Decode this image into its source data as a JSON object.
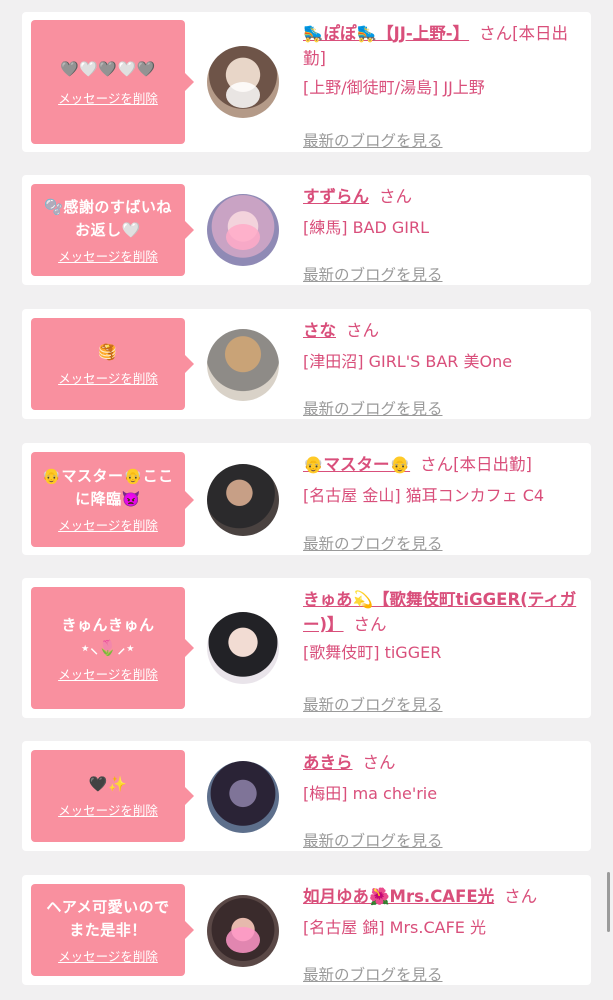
{
  "cards": [
    {
      "message": "🩶🤍🩶🤍🩶",
      "delete_label": "メッセージを削除",
      "name": "🛼ぽぽ🛼【JJ-上野-】",
      "san": "さん",
      "status": "[本日出勤]",
      "shop": "[上野/御徒町/湯島] JJ上野",
      "blog_label": "最新のブログを見る"
    },
    {
      "message": "🫧感謝のすばいね お返し🤍",
      "delete_label": "メッセージを削除",
      "name": "すずらん",
      "san": "さん",
      "status": "",
      "shop": "[練馬] BAD GIRL",
      "blog_label": "最新のブログを見る"
    },
    {
      "message": "🥞",
      "delete_label": "メッセージを削除",
      "name": "さな",
      "san": "さん",
      "status": "",
      "shop": "[津田沼] GIRL'S BAR 美One",
      "blog_label": "最新のブログを見る"
    },
    {
      "message": "👴マスター👴ここに降臨👿",
      "delete_label": "メッセージを削除",
      "name": "👴マスター👴",
      "san": "さん",
      "status": "[本日出勤]",
      "shop": "[名古屋 金山] 猫耳コンカフェ C4",
      "blog_label": "最新のブログを見る"
    },
    {
      "message": "きゅんきゅん ⋆⸜🌷⸝⋆",
      "delete_label": "メッセージを削除",
      "name": "きゅあ💫【歌舞伎町tiGGER(ティガー)】",
      "san": "さん",
      "status": "",
      "shop": "[歌舞伎町] tiGGER",
      "blog_label": "最新のブログを見る"
    },
    {
      "message": "🖤✨",
      "delete_label": "メッセージを削除",
      "name": "あきら",
      "san": "さん",
      "status": "",
      "shop": "[梅田] ma che'rie",
      "blog_label": "最新のブログを見る"
    },
    {
      "message": "ヘアメ可愛いので また是非！",
      "delete_label": "メッセージを削除",
      "name": "如月ゆあ🌺Mrs.CAFE光",
      "san": "さん",
      "status": "",
      "shop": "[名古屋 錦] Mrs.CAFE 光",
      "blog_label": "最新のブログを見る"
    }
  ],
  "colors": {
    "bubble": "#f9909f",
    "accent": "#d94f7b",
    "muted": "#9a9a9a",
    "background": "#f1f0f1"
  }
}
